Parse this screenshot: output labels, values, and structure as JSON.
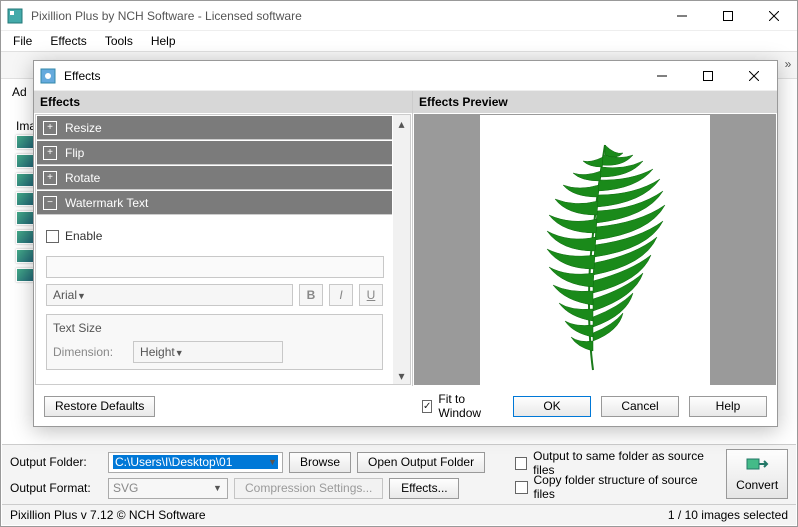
{
  "mainWindow": {
    "title": "Pixillion Plus by NCH Software - Licensed software",
    "menus": [
      "File",
      "Effects",
      "Tools",
      "Help"
    ],
    "addLabel": "Ad",
    "imagesLabel": "Ima"
  },
  "bottom": {
    "outputFolderLabel": "Output Folder:",
    "outputFolderValue": "C:\\Users\\I\\Desktop\\01",
    "browse": "Browse",
    "openOutputFolder": "Open Output Folder",
    "outputFormatLabel": "Output Format:",
    "outputFormatValue": "SVG",
    "compression": "Compression Settings...",
    "effects": "Effects...",
    "sameFolder": "Output to same folder as source files",
    "copyStructure": "Copy folder structure of source files",
    "convert": "Convert"
  },
  "status": {
    "left": "Pixillion Plus v 7.12 © NCH Software",
    "right": "1 / 10 images selected"
  },
  "dialog": {
    "title": "Effects",
    "leftHeader": "Effects",
    "rightHeader": "Effects Preview",
    "items": [
      {
        "label": "Resize",
        "expanded": false
      },
      {
        "label": "Flip",
        "expanded": false
      },
      {
        "label": "Rotate",
        "expanded": false
      },
      {
        "label": "Watermark Text",
        "expanded": true
      }
    ],
    "wm": {
      "enable": "Enable",
      "font": "Arial",
      "textSize": "Text Size",
      "dimensionLabel": "Dimension:",
      "dimensionValue": "Height"
    },
    "restoreDefaults": "Restore Defaults",
    "fitToWindow": "Fit to Window",
    "ok": "OK",
    "cancel": "Cancel",
    "help": "Help"
  }
}
